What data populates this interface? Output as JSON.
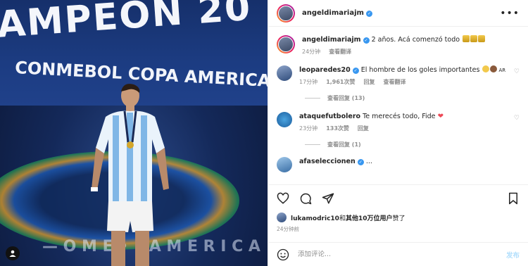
{
  "photo": {
    "banner_line1": "AMPEÓN 20",
    "banner_line2": "CONMEBOL COPA AMERICA",
    "floor_text": "— O M E • •  A M E R I C A"
  },
  "header": {
    "username": "angeldimariajm",
    "more_label": "•••"
  },
  "caption": {
    "username": "angeldimariajm",
    "text": "2 años. Acá comenzó todo",
    "time": "24分钟",
    "translate": "查看翻译"
  },
  "comments": [
    {
      "username": "leoparedes20",
      "text": "El hombre de los goles importantes",
      "suffix": "AR",
      "time": "17分钟",
      "likes": "1,961次赞",
      "reply": "回复",
      "translate": "查看翻译",
      "view_replies": "查看回复 (13)"
    },
    {
      "username": "ataquefutbolero",
      "text": "Te merecés todo, Fide",
      "time": "23分钟",
      "likes": "133次赞",
      "reply": "回复",
      "view_replies": "查看回复 (1)"
    },
    {
      "username": "afaseleccionen",
      "text": "..."
    }
  ],
  "likes_line": {
    "user": "lukamodric10",
    "and": "和",
    "others": "其他10万位用户",
    "liked": "赞了"
  },
  "post_time": "24分钟前",
  "add_comment": {
    "placeholder": "添加评论...",
    "post_label": "发布"
  },
  "colors": {
    "accent": "#3897f0",
    "heart": "#ed4956"
  }
}
